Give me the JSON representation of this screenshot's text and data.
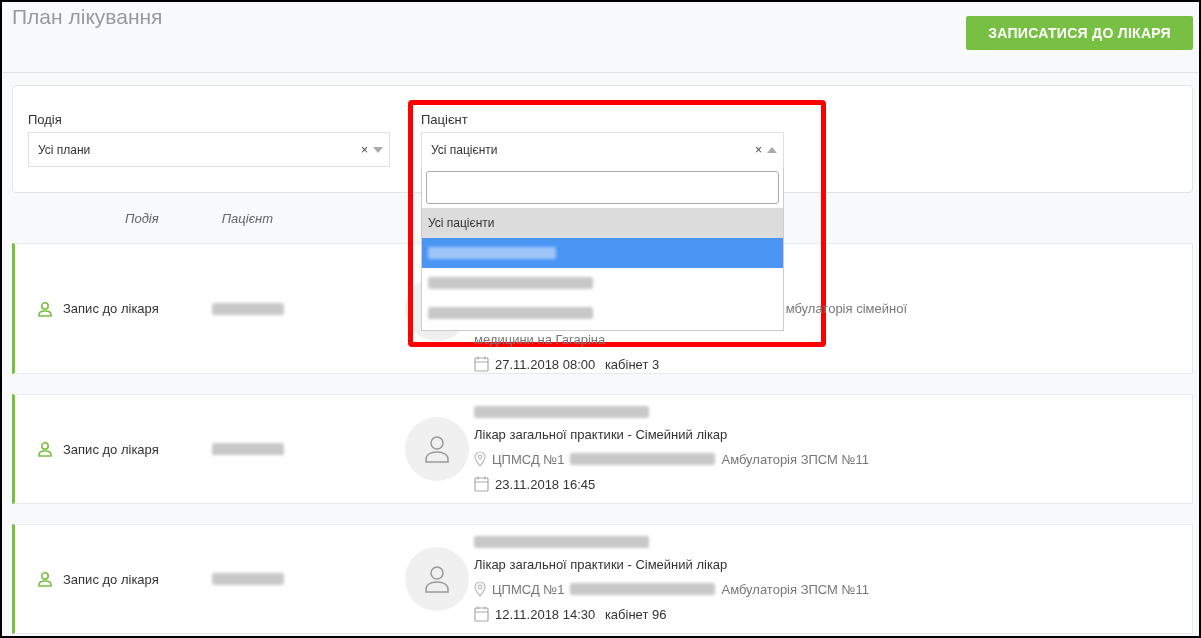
{
  "page": {
    "title": "План лікування",
    "action_button": "ЗАПИСАТИСЯ ДО ЛІКАРЯ"
  },
  "filters": [
    {
      "label": "Подія",
      "value": "Усі плани",
      "open": false,
      "clear": "×"
    },
    {
      "label": "Пацієнт",
      "value": "Усі пацієнти",
      "open": true,
      "clear": "×"
    }
  ],
  "dropdown": {
    "options": [
      {
        "kind": "text",
        "label": "Усі пацієнти",
        "selected": false
      },
      {
        "kind": "redacted",
        "selected": true
      },
      {
        "kind": "redacted",
        "selected": false
      },
      {
        "kind": "redacted",
        "selected": false
      }
    ]
  },
  "annotation": {
    "kind": "highlight-frame"
  },
  "columns": [
    "Подія",
    "Пацієнт"
  ],
  "appointments": [
    {
      "event": "Запис до лікаря",
      "doctor_shown": false,
      "address_lines": [
        "мбулаторія сімейної",
        "медицини на Гагаріна"
      ],
      "date": "27.11.2018 08:00",
      "room": "кабінет 3"
    },
    {
      "event": "Запис до лікаря",
      "doctor_shown": true,
      "specialty": "Лікар загальної практики - Сімейний лікар",
      "address_lines": [
        "ЦПМСД №1",
        "Амбулаторія ЗПСМ №11"
      ],
      "date": "23.11.2018 16:45"
    },
    {
      "event": "Запис до лікаря",
      "doctor_shown": true,
      "specialty": "Лікар загальної практики - Сімейний лікар",
      "address_lines": [
        "ЦПМСД №1",
        "Амбулаторія ЗПСМ №11"
      ],
      "date": "12.11.2018 14:30",
      "room": "кабінет 96"
    }
  ]
}
